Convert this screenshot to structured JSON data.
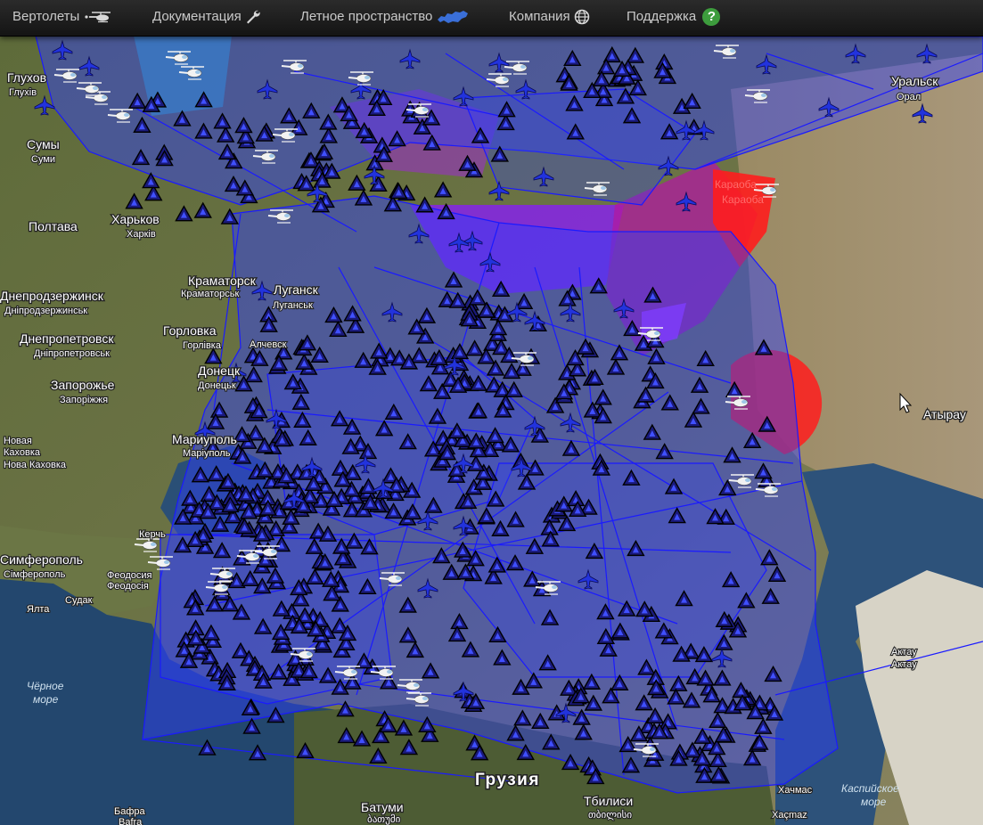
{
  "navbar": {
    "items": [
      {
        "label": "Вертолеты",
        "icon": "helicopter-icon"
      },
      {
        "label": "Документация",
        "icon": "wrench-icon"
      },
      {
        "label": "Летное пространство",
        "icon": "russia-map-icon"
      },
      {
        "label": "Компания",
        "icon": "globe-icon"
      },
      {
        "label": "Поддержка",
        "icon": "help-icon"
      }
    ],
    "help_glyph": "?"
  },
  "map": {
    "colors": {
      "airspace_fill": "#2f3fff",
      "airspace_stroke": "#1a1aff",
      "restricted_fill": "#ff1d1d",
      "danger_fill": "#b01aa0",
      "violet_fill": "#8a1aff",
      "triangle_fill": "#1a1a7a",
      "plane_fill": "#2233dd",
      "land": "#6f7a4a",
      "sea": "#1f3f63"
    },
    "labels": {
      "cities": [
        {
          "name": "Глухов",
          "sub": "Глухів"
        },
        {
          "name": "Сумы",
          "sub": "Суми"
        },
        {
          "name": "Полтава",
          "sub": ""
        },
        {
          "name": "Харьков",
          "sub": "Харків"
        },
        {
          "name": "Днепродзержинск",
          "sub": "Дніпродзержинськ"
        },
        {
          "name": "Днепропетровск",
          "sub": "Дніпропетровськ"
        },
        {
          "name": "Краматорск",
          "sub": "Краматорськ"
        },
        {
          "name": "Луганск",
          "sub": "Луганськ"
        },
        {
          "name": "Горловка",
          "sub": "Горлівка"
        },
        {
          "name": "Алчевск",
          "sub": ""
        },
        {
          "name": "Донецк",
          "sub": "Донецьк"
        },
        {
          "name": "Запорожье",
          "sub": "Запоріжжя"
        },
        {
          "name": "Мариуполь",
          "sub": "Маріуполь"
        },
        {
          "name": "Новая Каховка",
          "sub": "Нова Каховка"
        },
        {
          "name": "Керчь",
          "sub": ""
        },
        {
          "name": "Симферополь",
          "sub": "Сімферополь"
        },
        {
          "name": "Феодосия",
          "sub": "Феодосія"
        },
        {
          "name": "Судак",
          "sub": ""
        },
        {
          "name": "Ялта",
          "sub": ""
        },
        {
          "name": "Батуми",
          "sub": "ბათუმი"
        },
        {
          "name": "Тбилиси",
          "sub": "თბილისი"
        },
        {
          "name": "Хачмас",
          "sub": "Xaçmaz"
        },
        {
          "name": "Уральск",
          "sub": "Орал"
        },
        {
          "name": "Атырау",
          "sub": ""
        },
        {
          "name": "Актау",
          "sub": "Актау"
        },
        {
          "name": "Бафра",
          "sub": "Bafra"
        }
      ],
      "country": "Грузия",
      "seas": [
        "Чёрное море",
        "Каспийское море"
      ],
      "zone": "Караоба"
    }
  }
}
